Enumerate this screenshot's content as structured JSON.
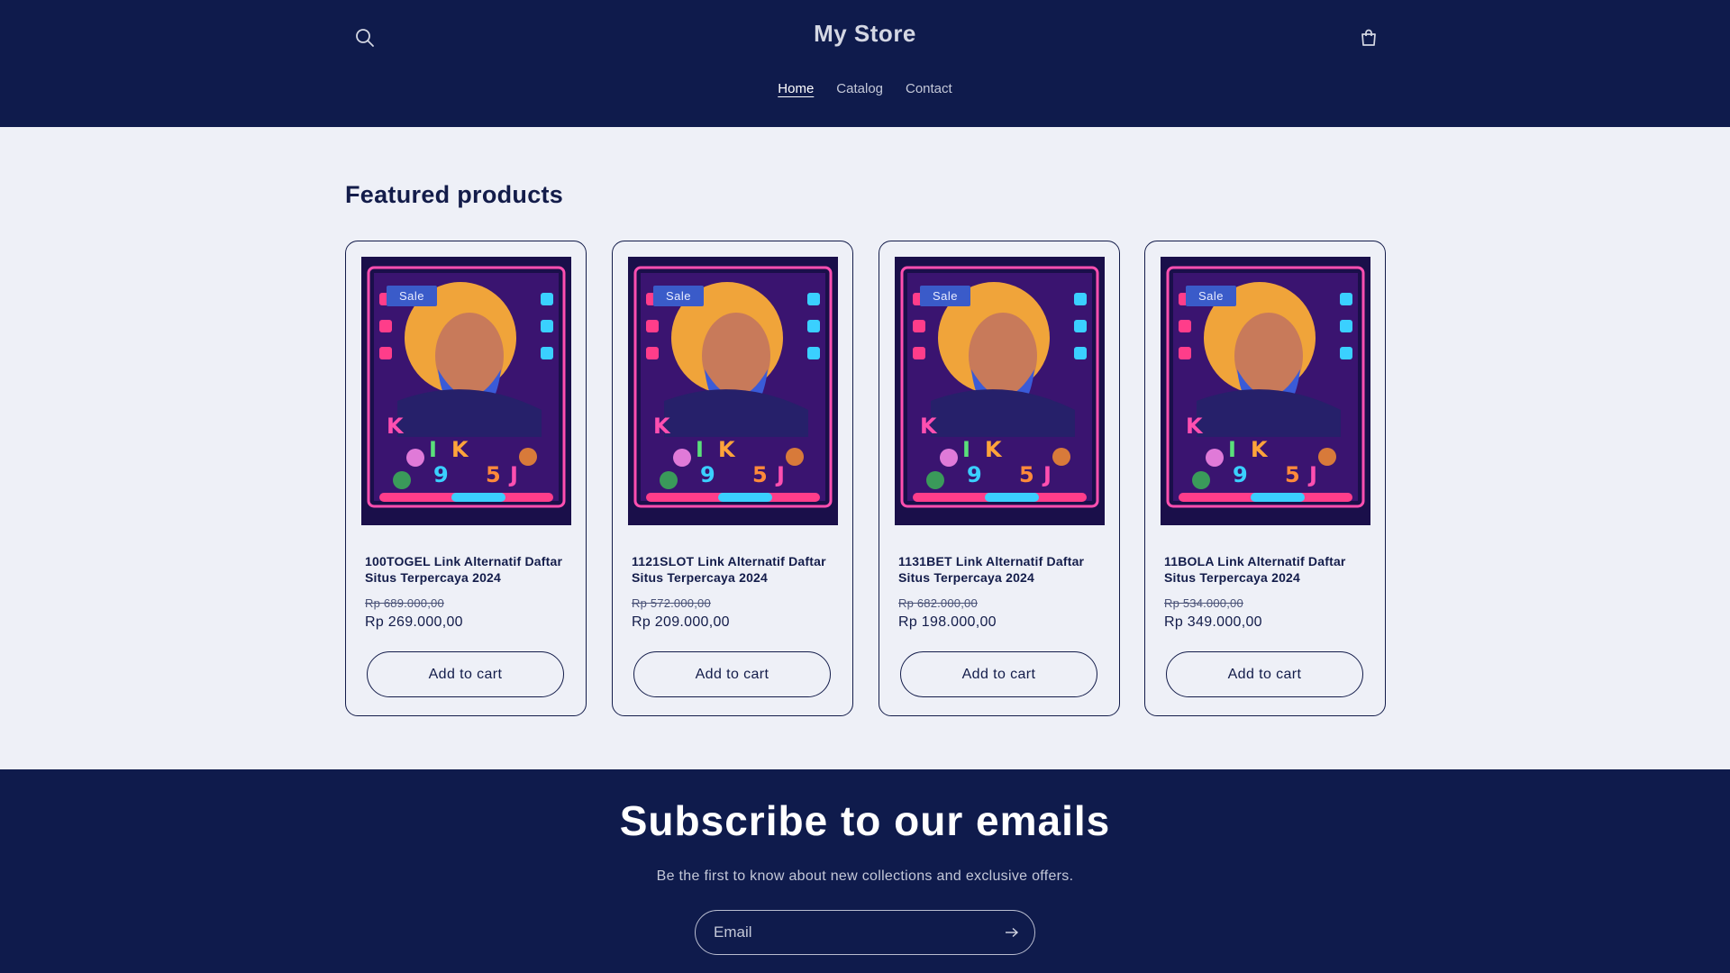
{
  "header": {
    "logo": "My Store",
    "search_icon": "search-icon",
    "cart_icon": "cart-icon",
    "nav": [
      {
        "label": "Home",
        "active": true
      },
      {
        "label": "Catalog",
        "active": false
      },
      {
        "label": "Contact",
        "active": false
      }
    ]
  },
  "featured": {
    "title": "Featured products",
    "products": [
      {
        "badge": "Sale",
        "title": "100TOGEL Link Alternatif Daftar Situs Terpercaya 2024",
        "price_old": "Rp 689.000,00",
        "price_new": "Rp 269.000,00",
        "button": "Add to cart"
      },
      {
        "badge": "Sale",
        "title": "1121SLOT Link Alternatif Daftar Situs Terpercaya 2024",
        "price_old": "Rp 572.000,00",
        "price_new": "Rp 209.000,00",
        "button": "Add to cart"
      },
      {
        "badge": "Sale",
        "title": "1131BET Link Alternatif Daftar Situs Terpercaya 2024",
        "price_old": "Rp 682.000,00",
        "price_new": "Rp 198.000,00",
        "button": "Add to cart"
      },
      {
        "badge": "Sale",
        "title": "11BOLA Link Alternatif Daftar Situs Terpercaya 2024",
        "price_old": "Rp 534.000,00",
        "price_new": "Rp 349.000,00",
        "button": "Add to cart"
      }
    ]
  },
  "newsletter": {
    "title": "Subscribe to our emails",
    "subtitle": "Be the first to know about new collections and exclusive offers.",
    "email_placeholder": "Email",
    "submit_icon": "arrow-right-icon"
  },
  "colors": {
    "header_bg": "#0f1b4c",
    "page_bg": "#eef0f7",
    "text": "#131c4a",
    "sale_badge": "#3a5bc9"
  }
}
